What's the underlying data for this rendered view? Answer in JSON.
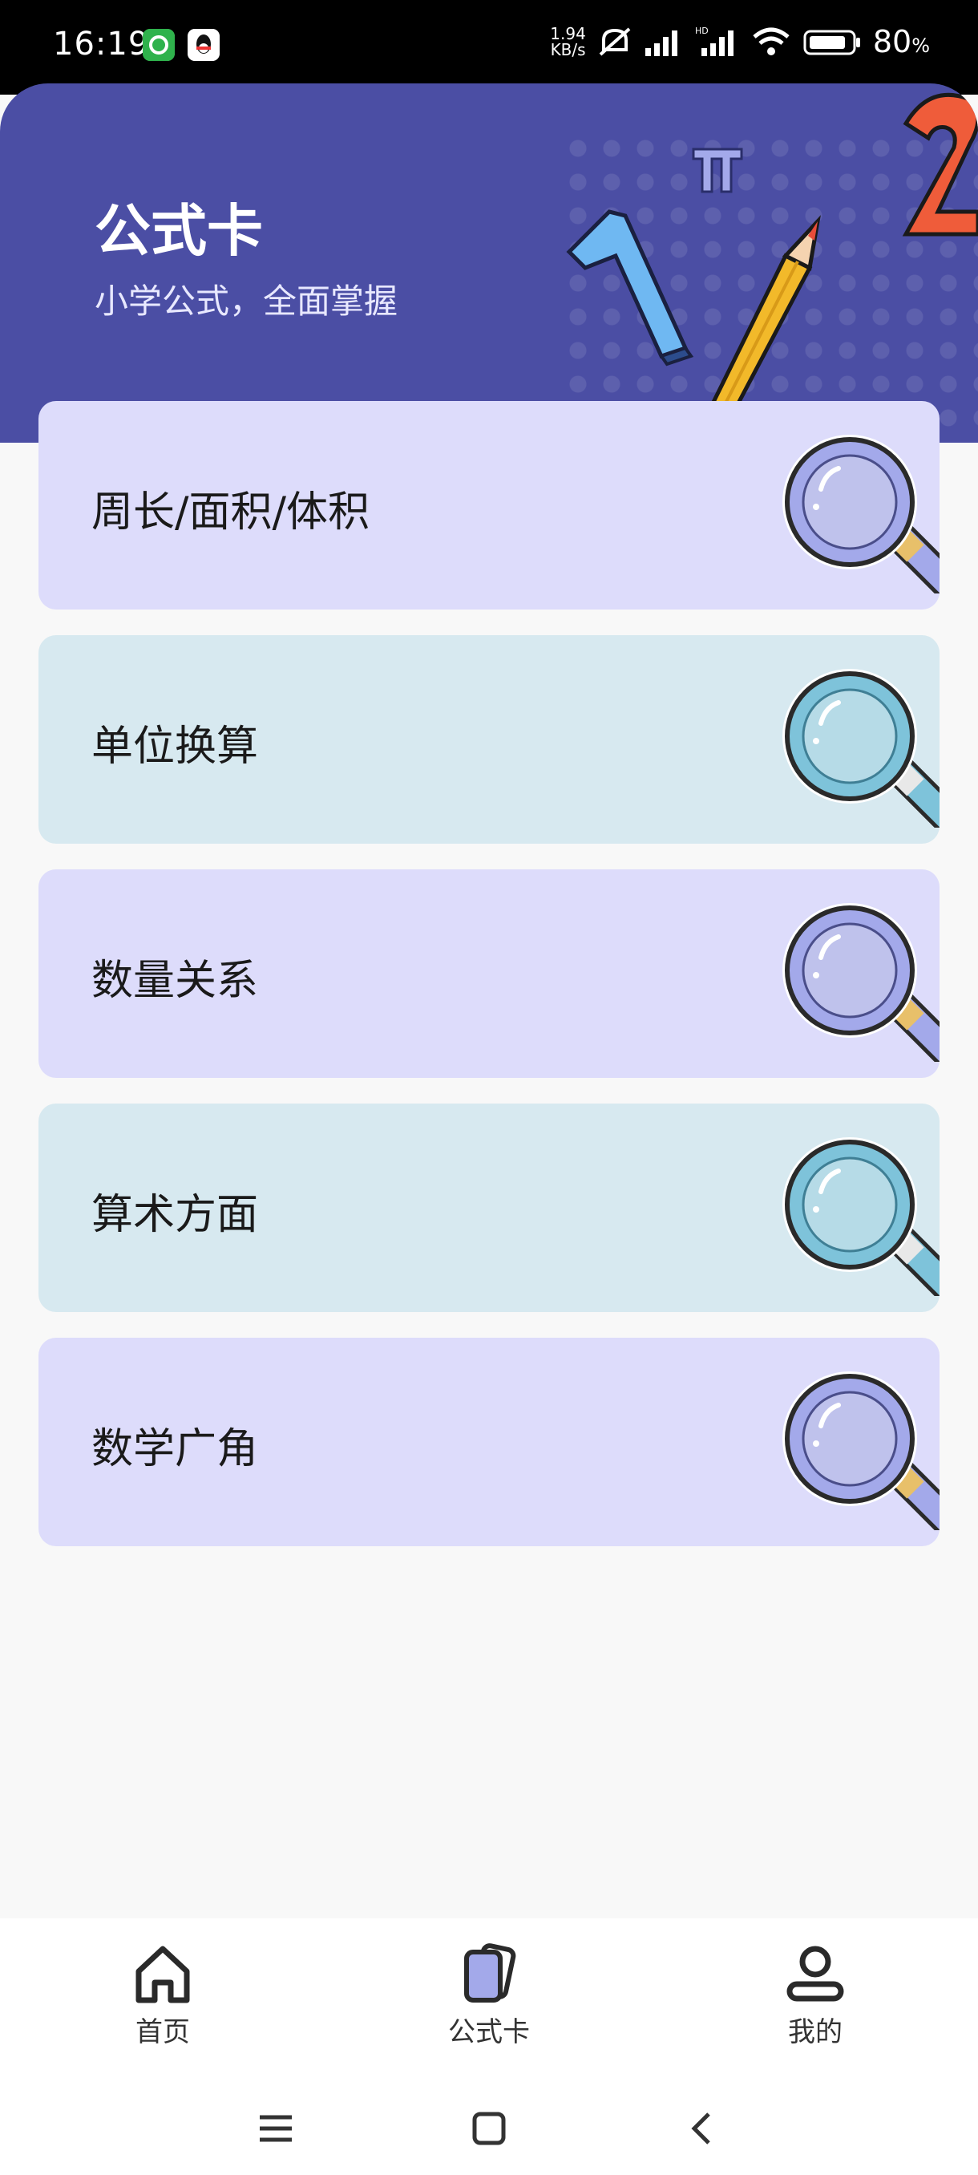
{
  "status_bar": {
    "time": "16:19",
    "net_speed_value": "1.94",
    "net_speed_unit": "KB/s",
    "battery_percent": "80",
    "battery_unit": "%"
  },
  "header": {
    "title": "公式卡",
    "subtitle": "小学公式，全面掌握"
  },
  "cards": [
    {
      "label": "周长/面积/体积",
      "theme": "violet"
    },
    {
      "label": "单位换算",
      "theme": "teal"
    },
    {
      "label": "数量关系",
      "theme": "violet"
    },
    {
      "label": "算术方面",
      "theme": "teal"
    },
    {
      "label": "数学广角",
      "theme": "violet"
    }
  ],
  "bottom_nav": {
    "items": [
      {
        "label": "首页",
        "icon": "home-icon"
      },
      {
        "label": "公式卡",
        "icon": "cards-icon",
        "active": true
      },
      {
        "label": "我的",
        "icon": "user-icon"
      }
    ]
  },
  "colors": {
    "header_bg": "#4b4ea4",
    "card_violet": "#dddcfb",
    "card_teal": "#d7e9f0",
    "accent": "#a3a9ea"
  }
}
